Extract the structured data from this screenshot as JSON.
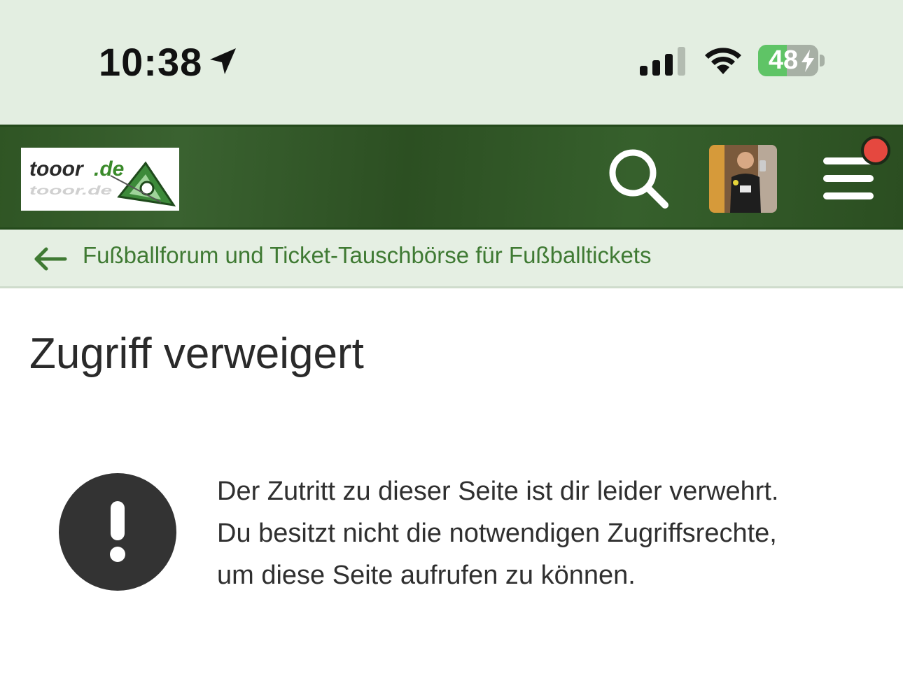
{
  "status_bar": {
    "time": "10:38",
    "battery_level": "48",
    "battery_fraction": 0.48
  },
  "header": {
    "logo_alt": "tooor.de",
    "icons": [
      "search-icon",
      "avatar",
      "menu-icon"
    ],
    "notification_color": "#e5483f",
    "background_color": "#2f5524"
  },
  "breadcrumb": {
    "label": "Fußballforum und Ticket-Tauschbörse für Fußballtickets"
  },
  "page": {
    "title": "Zugriff verweigert"
  },
  "alert": {
    "icon": "exclamation-icon",
    "lines": [
      "Der Zutritt zu dieser Seite ist dir leider verwehrt.",
      "Du besitzt nicht die notwendigen Zugriffsrechte,",
      "um diese Seite aufrufen zu können."
    ]
  }
}
